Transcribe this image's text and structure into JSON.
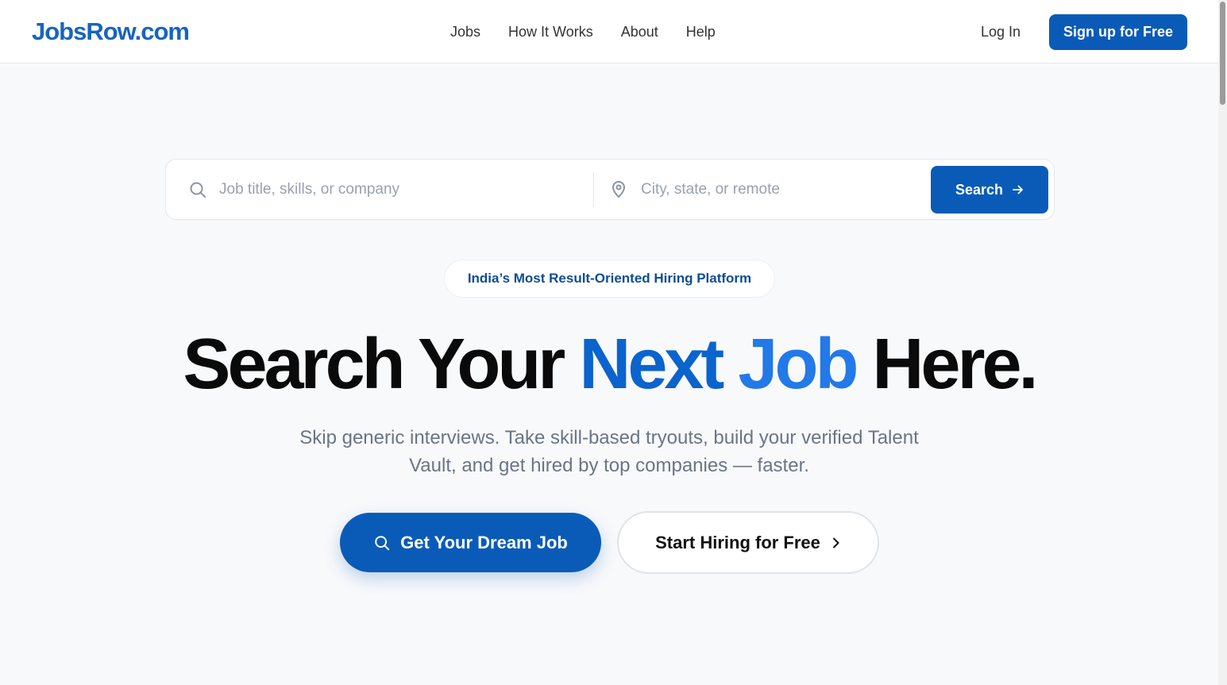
{
  "header": {
    "logo": "JobsRow.com",
    "nav": [
      "Jobs",
      "How It Works",
      "About",
      "Help"
    ],
    "login_label": "Log In",
    "signup_label": "Sign up for Free"
  },
  "search": {
    "keyword_placeholder": "Job title, skills, or company",
    "location_placeholder": "City, state, or remote",
    "button_label": "Search"
  },
  "hero": {
    "badge": "India’s Most Result-Oriented Hiring Platform",
    "headline_part1": "Search Your ",
    "headline_part2": "Next",
    "headline_part3": " Job",
    "headline_part4": " Here.",
    "subtitle": "Skip generic interviews. Take skill-based tryouts, build your verified Talent Vault, and get hired by top companies — faster.",
    "cta_primary": "Get Your Dream Job",
    "cta_secondary": "Start Hiring for Free"
  },
  "colors": {
    "brand": "#0a5bb8",
    "logo": "#1764c0",
    "accent_blue": "#2379e8"
  },
  "icons": {
    "keyword": "search-icon",
    "location": "map-pin-icon",
    "search_button": "arrow-right-icon",
    "cta_primary": "search-icon",
    "cta_secondary": "chevron-right-icon"
  }
}
